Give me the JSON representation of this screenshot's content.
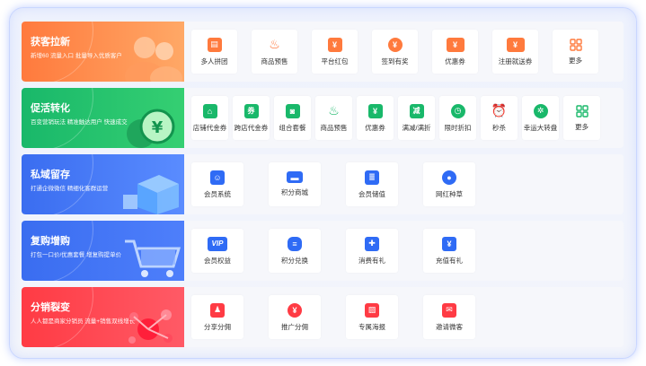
{
  "sections": [
    {
      "title": "获客拉新",
      "subtitle": "新增60 流量入口 批量导入优质客户",
      "color": "#ff7a3d",
      "items": [
        {
          "label": "多人拼团",
          "icon": "group-buy-icon"
        },
        {
          "label": "商品预售",
          "icon": "flame-icon"
        },
        {
          "label": "平台红包",
          "icon": "red-packet-icon"
        },
        {
          "label": "签到有奖",
          "icon": "money-bag-icon"
        },
        {
          "label": "优惠券",
          "icon": "coupon-icon"
        },
        {
          "label": "注册就送券",
          "icon": "ticket-icon"
        },
        {
          "label": "更多",
          "icon": "grid-icon"
        }
      ]
    },
    {
      "title": "促活转化",
      "subtitle": "百变营销玩法 精准触达用户 快速成交",
      "color": "#19b86a",
      "items": [
        {
          "label": "店铺代金券",
          "icon": "shop-icon"
        },
        {
          "label": "跨店代金券",
          "icon": "voucher-icon"
        },
        {
          "label": "组合套餐",
          "icon": "bag-icon"
        },
        {
          "label": "商品预售",
          "icon": "flame-icon"
        },
        {
          "label": "优惠券",
          "icon": "coupon-icon"
        },
        {
          "label": "满减/满折",
          "icon": "discount-icon"
        },
        {
          "label": "限时折扣",
          "icon": "timer-icon"
        },
        {
          "label": "秒杀",
          "icon": "alarm-icon"
        },
        {
          "label": "幸运大转盘",
          "icon": "wheel-icon"
        },
        {
          "label": "更多",
          "icon": "grid-icon"
        }
      ]
    },
    {
      "title": "私域留存",
      "subtitle": "打通企微微信 精细化客群运营",
      "color": "#3a6df0",
      "items": [
        {
          "label": "会员系统",
          "icon": "member-card-icon"
        },
        {
          "label": "积分商城",
          "icon": "mall-icon"
        },
        {
          "label": "会员储值",
          "icon": "wallet-icon"
        },
        {
          "label": "网红种草",
          "icon": "influencer-icon"
        }
      ]
    },
    {
      "title": "复购增购",
      "subtitle": "打包一口价/优惠套餐 增复购提单价",
      "color": "#3a6df0",
      "items": [
        {
          "label": "会员权益",
          "icon": "vip-icon"
        },
        {
          "label": "积分兑换",
          "icon": "coins-icon"
        },
        {
          "label": "消费有礼",
          "icon": "gift-icon"
        },
        {
          "label": "充值有礼",
          "icon": "recharge-icon"
        }
      ]
    },
    {
      "title": "分销裂变",
      "subtitle": "人人都是商家分销员 流量+销售双线增长",
      "color": "#ff3b44",
      "items": [
        {
          "label": "分享分佣",
          "icon": "share-icon"
        },
        {
          "label": "推广分佣",
          "icon": "promote-icon"
        },
        {
          "label": "专属海报",
          "icon": "poster-icon"
        },
        {
          "label": "邀请微客",
          "icon": "invite-icon"
        }
      ]
    }
  ]
}
